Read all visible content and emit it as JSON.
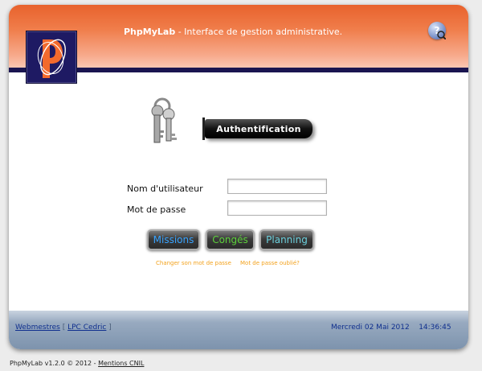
{
  "header": {
    "app_name": "PhpMyLab",
    "subtitle": " - Interface de gestion administrative.",
    "help_icon": "help-icon",
    "logo_icon": "phpmylab-logo"
  },
  "auth": {
    "banner": "Authentification",
    "keys_icon": "keys-icon",
    "username_label": "Nom d'utilisateur",
    "password_label": "Mot de passe",
    "username_value": "",
    "password_value": ""
  },
  "buttons": {
    "missions": "Missions",
    "conges": "Congés",
    "planning": "Planning"
  },
  "links": {
    "change_password": "Changer son mot de passe",
    "forgot_password": "Mot de passe oublié?"
  },
  "footer": {
    "webmasters": "Webmestres",
    "sep_open": " [ ",
    "contact": "LPC Cedric",
    "sep_close": " ]",
    "date": "Mercredi 02 Mai 2012",
    "time": "14:36:45"
  },
  "bottom": {
    "version": "PhpMyLab v1.2.0 © 2012 - ",
    "mentions": "Mentions CNIL"
  },
  "colors": {
    "header_orange": "#e8622c",
    "navy": "#1a1550",
    "missions": "#38a3ff",
    "conges": "#5cd13b",
    "planning": "#6cd0dd",
    "link_orange": "#f3a21d"
  }
}
